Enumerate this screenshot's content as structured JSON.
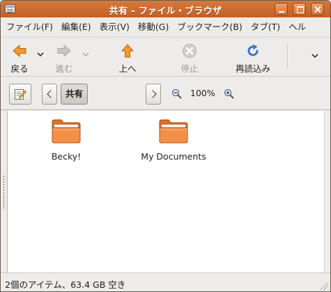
{
  "window": {
    "title": "共有 - ファイル・ブラウザ"
  },
  "menu": {
    "items": [
      "ファイル(F)",
      "編集(E)",
      "表示(V)",
      "移動(G)",
      "ブックマーク(B)",
      "タブ(T)",
      "ヘル"
    ]
  },
  "toolbar": {
    "back_label": "戻る",
    "forward_label": "進む",
    "up_label": "上へ",
    "stop_label": "停止",
    "reload_label": "再読込み"
  },
  "location": {
    "path_segment": "共有",
    "zoom_level": "100%"
  },
  "files": [
    {
      "name": "Becky!"
    },
    {
      "name": "My Documents"
    }
  ],
  "status": {
    "text": "2個のアイテム、63.4 GB 空き"
  },
  "colors": {
    "titlebar": "#c96a2e",
    "folder": "#f08a3c",
    "nav_arrow": "#f59a2f",
    "reload": "#3f73c6"
  },
  "icons": {
    "back": "arrow-left-icon",
    "forward": "arrow-right-icon",
    "up": "arrow-up-icon",
    "stop": "stop-icon",
    "reload": "reload-icon",
    "edit": "edit-location-icon",
    "zoom_out": "zoom-out-icon",
    "zoom_in": "zoom-in-icon",
    "folder": "folder-icon"
  }
}
